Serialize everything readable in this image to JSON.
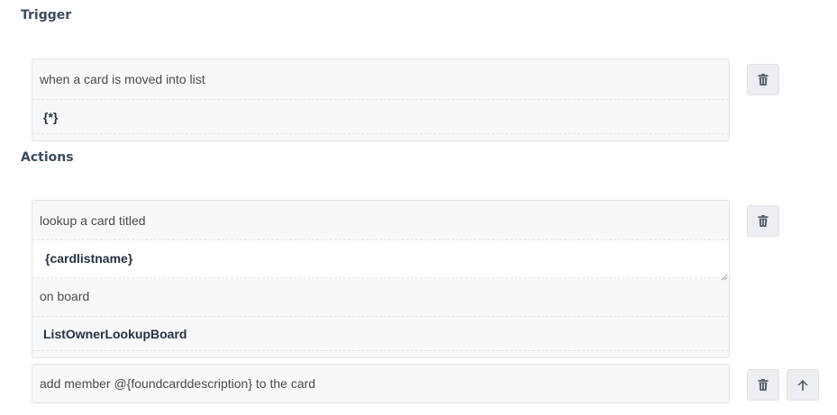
{
  "trigger": {
    "title": "Trigger",
    "phrase": "when a card is moved into list",
    "value": "{*}"
  },
  "actions": {
    "title": "Actions",
    "lookup": {
      "phrase": "lookup a card titled",
      "title_value": "{cardlistname}",
      "board_phrase": "on board",
      "board_value": "ListOwnerLookupBoard"
    },
    "add_member": {
      "phrase": "add member @{foundcarddescription} to the card"
    }
  },
  "icons": {
    "delete": "trash-icon",
    "move_up": "arrow-up-icon"
  },
  "colors": {
    "heading": "#3b4c5e",
    "button_bg": "#eceef1",
    "icon": "#5a6370"
  }
}
